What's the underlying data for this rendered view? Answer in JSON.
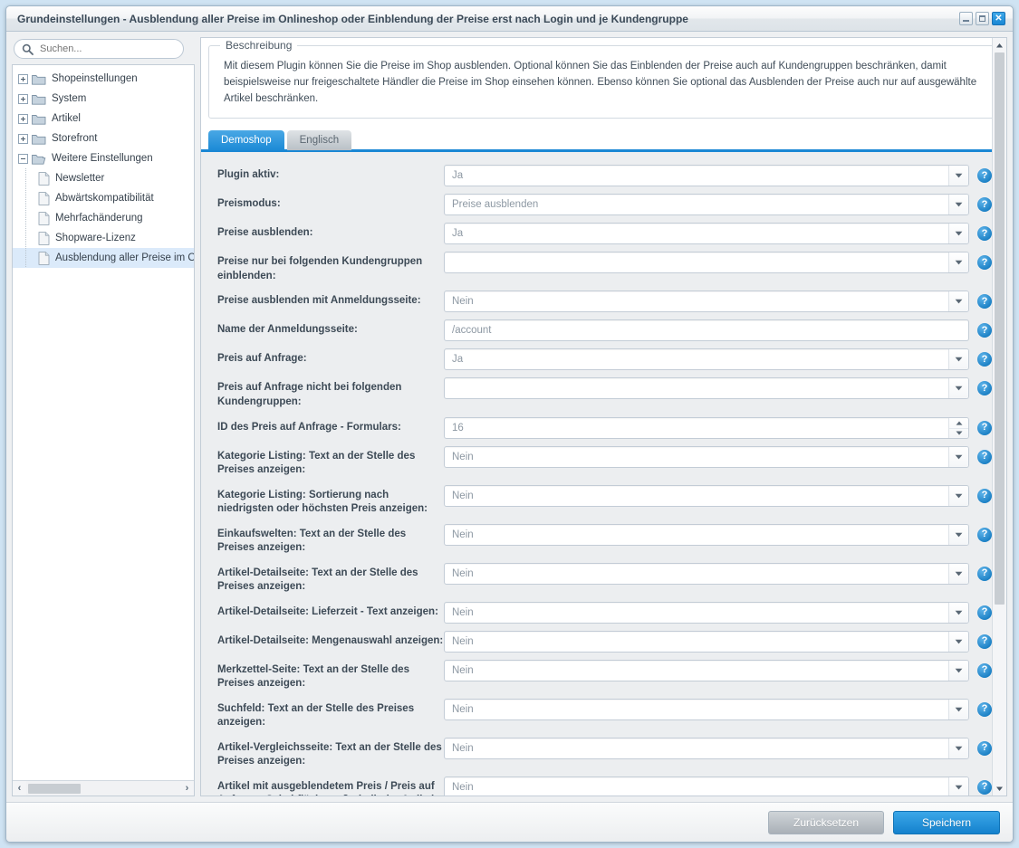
{
  "window": {
    "title": "Grundeinstellungen - Ausblendung aller Preise im Onlineshop oder Einblendung der Preise erst nach Login und je Kundengruppe",
    "controls": {
      "minimize": "minimize-icon",
      "maximize": "maximize-icon",
      "close": "✕"
    }
  },
  "sidebar": {
    "search": {
      "placeholder": "Suchen...",
      "value": "",
      "icon": "search-icon"
    },
    "tree": [
      {
        "label": "Shopeinstellungen",
        "type": "folder",
        "expanded": false,
        "selected": false
      },
      {
        "label": "System",
        "type": "folder",
        "expanded": false,
        "selected": false
      },
      {
        "label": "Artikel",
        "type": "folder",
        "expanded": false,
        "selected": false
      },
      {
        "label": "Storefront",
        "type": "folder",
        "expanded": false,
        "selected": false
      },
      {
        "label": "Weitere Einstellungen",
        "type": "folder",
        "expanded": true,
        "selected": false
      },
      {
        "label": "Newsletter",
        "type": "file",
        "selected": false
      },
      {
        "label": "Abwärtskompatibilität",
        "type": "file",
        "selected": false
      },
      {
        "label": "Mehrfachänderung",
        "type": "file",
        "selected": false
      },
      {
        "label": "Shopware-Lizenz",
        "type": "file",
        "selected": false
      },
      {
        "label": "Ausblendung aller Preise im On",
        "type": "file",
        "selected": true
      }
    ],
    "hscroll": {
      "left_arrow": "‹",
      "right_arrow": "›"
    }
  },
  "description": {
    "legend": "Beschreibung",
    "text": "Mit diesem Plugin können Sie die Preise im Shop ausblenden. Optional können Sie das Einblenden der Preise auch auf Kundengruppen beschränken, damit beispielsweise nur freigeschaltete Händler die Preise im Shop einsehen können. Ebenso können Sie optional das Ausblenden der Preise auch nur auf ausgewählte Artikel beschränken."
  },
  "tabs": [
    {
      "label": "Demoshop",
      "active": true
    },
    {
      "label": "Englisch",
      "active": false
    }
  ],
  "form": {
    "help_glyph": "?",
    "rows": [
      {
        "label": "Plugin aktiv:",
        "value": "Ja",
        "control": "select"
      },
      {
        "label": "Preismodus:",
        "value": "Preise ausblenden",
        "control": "select"
      },
      {
        "label": "Preise ausblenden:",
        "value": "Ja",
        "control": "select"
      },
      {
        "label": "Preise nur bei folgenden Kundengruppen einblenden:",
        "value": "",
        "control": "select"
      },
      {
        "label": "Preise ausblenden mit Anmeldungsseite:",
        "value": "Nein",
        "control": "select"
      },
      {
        "label": "Name der Anmeldungsseite:",
        "value": "/account",
        "control": "text"
      },
      {
        "label": "Preis auf Anfrage:",
        "value": "Ja",
        "control": "select"
      },
      {
        "label": "Preis auf Anfrage nicht bei folgenden Kundengruppen:",
        "value": "",
        "control": "select"
      },
      {
        "label": "ID des Preis auf Anfrage - Formulars:",
        "value": "16",
        "control": "spinner"
      },
      {
        "label": "Kategorie Listing: Text an der Stelle des Preises anzeigen:",
        "value": "Nein",
        "control": "select"
      },
      {
        "label": "Kategorie Listing: Sortierung nach niedrigsten oder höchsten Preis anzeigen:",
        "value": "Nein",
        "control": "select"
      },
      {
        "label": "Einkaufswelten: Text an der Stelle des Preises anzeigen:",
        "value": "Nein",
        "control": "select"
      },
      {
        "label": "Artikel-Detailseite: Text an der Stelle des Preises anzeigen:",
        "value": "Nein",
        "control": "select"
      },
      {
        "label": "Artikel-Detailseite: Lieferzeit - Text anzeigen:",
        "value": "Nein",
        "control": "select"
      },
      {
        "label": "Artikel-Detailseite: Mengenauswahl anzeigen:",
        "value": "Nein",
        "control": "select"
      },
      {
        "label": "Merkzettel-Seite: Text an der Stelle des Preises anzeigen:",
        "value": "Nein",
        "control": "select"
      },
      {
        "label": "Suchfeld: Text an der Stelle des Preises anzeigen:",
        "value": "Nein",
        "control": "select"
      },
      {
        "label": "Artikel-Vergleichsseite: Text an der Stelle des Preises anzeigen:",
        "value": "Nein",
        "control": "select"
      },
      {
        "label": "Artikel mit ausgeblendetem Preis / Preis auf Anfrage - Schaltfläche außerhalb der Artikel-Detailseite bestellbar:",
        "value": "Nein",
        "control": "select"
      }
    ]
  },
  "footer": {
    "reset_label": "Zurücksetzen",
    "save_label": "Speichern"
  },
  "colors": {
    "accent": "#1a87d4",
    "help_blue": "#1a7fc4",
    "selected_row": "#dbeafa"
  }
}
